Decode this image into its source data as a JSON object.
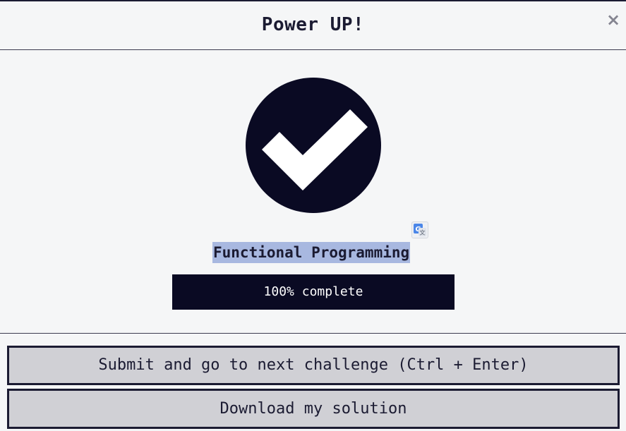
{
  "modal": {
    "title": "Power UP!",
    "close_label": "×"
  },
  "course": {
    "title": "Functional Programming",
    "progress_percent": 100,
    "progress_text": "100% complete"
  },
  "actions": {
    "submit_label": "Submit and go to next challenge (Ctrl + Enter)",
    "download_label": "Download my solution"
  },
  "colors": {
    "dark": "#0a0a23",
    "text": "#1b1b32",
    "button_bg": "#d0d0d5",
    "highlight": "#a8b8e0",
    "background": "#f5f6f7"
  },
  "icons": {
    "completion": "check-circle-icon",
    "translate": "google-translate-icon",
    "close": "close-icon"
  }
}
